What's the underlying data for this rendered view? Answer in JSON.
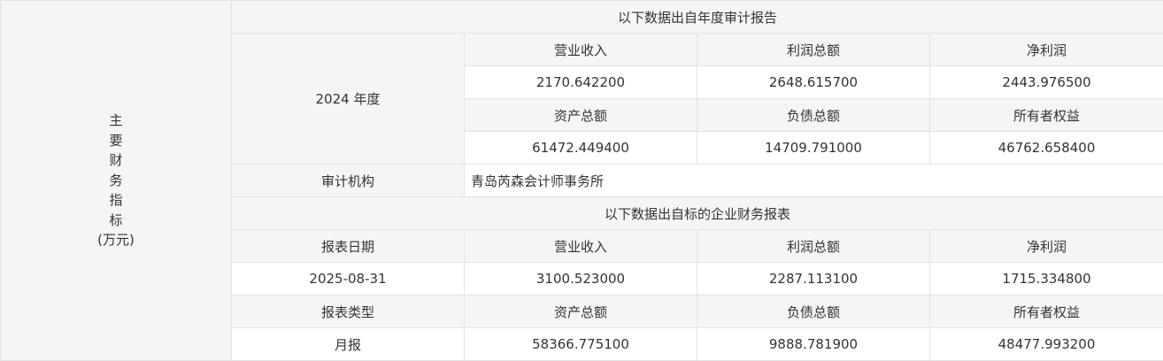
{
  "side_label_chars": [
    "主",
    "要",
    "财",
    "务",
    "指",
    "标"
  ],
  "side_label_unit": "(万元)",
  "audit": {
    "section_title": "以下数据出自年度审计报告",
    "year": "2024 年度",
    "headers_1": [
      "营业收入",
      "利润总额",
      "净利润"
    ],
    "values_1": [
      "2170.642200",
      "2648.615700",
      "2443.976500"
    ],
    "headers_2": [
      "资产总额",
      "负债总额",
      "所有者权益"
    ],
    "values_2": [
      "61472.449400",
      "14709.791000",
      "46762.658400"
    ],
    "agency_label": "审计机构",
    "agency_value": "青岛芮森会计师事务所"
  },
  "report": {
    "section_title": "以下数据出自标的企业财务报表",
    "date_label": "报表日期",
    "date_value": "2025-08-31",
    "headers_1": [
      "营业收入",
      "利润总额",
      "净利润"
    ],
    "values_1": [
      "3100.523000",
      "2287.113100",
      "1715.334800"
    ],
    "type_label": "报表类型",
    "type_value": "月报",
    "headers_2": [
      "资产总额",
      "负债总额",
      "所有者权益"
    ],
    "values_2": [
      "58366.775100",
      "9888.781900",
      "48477.993200"
    ]
  }
}
